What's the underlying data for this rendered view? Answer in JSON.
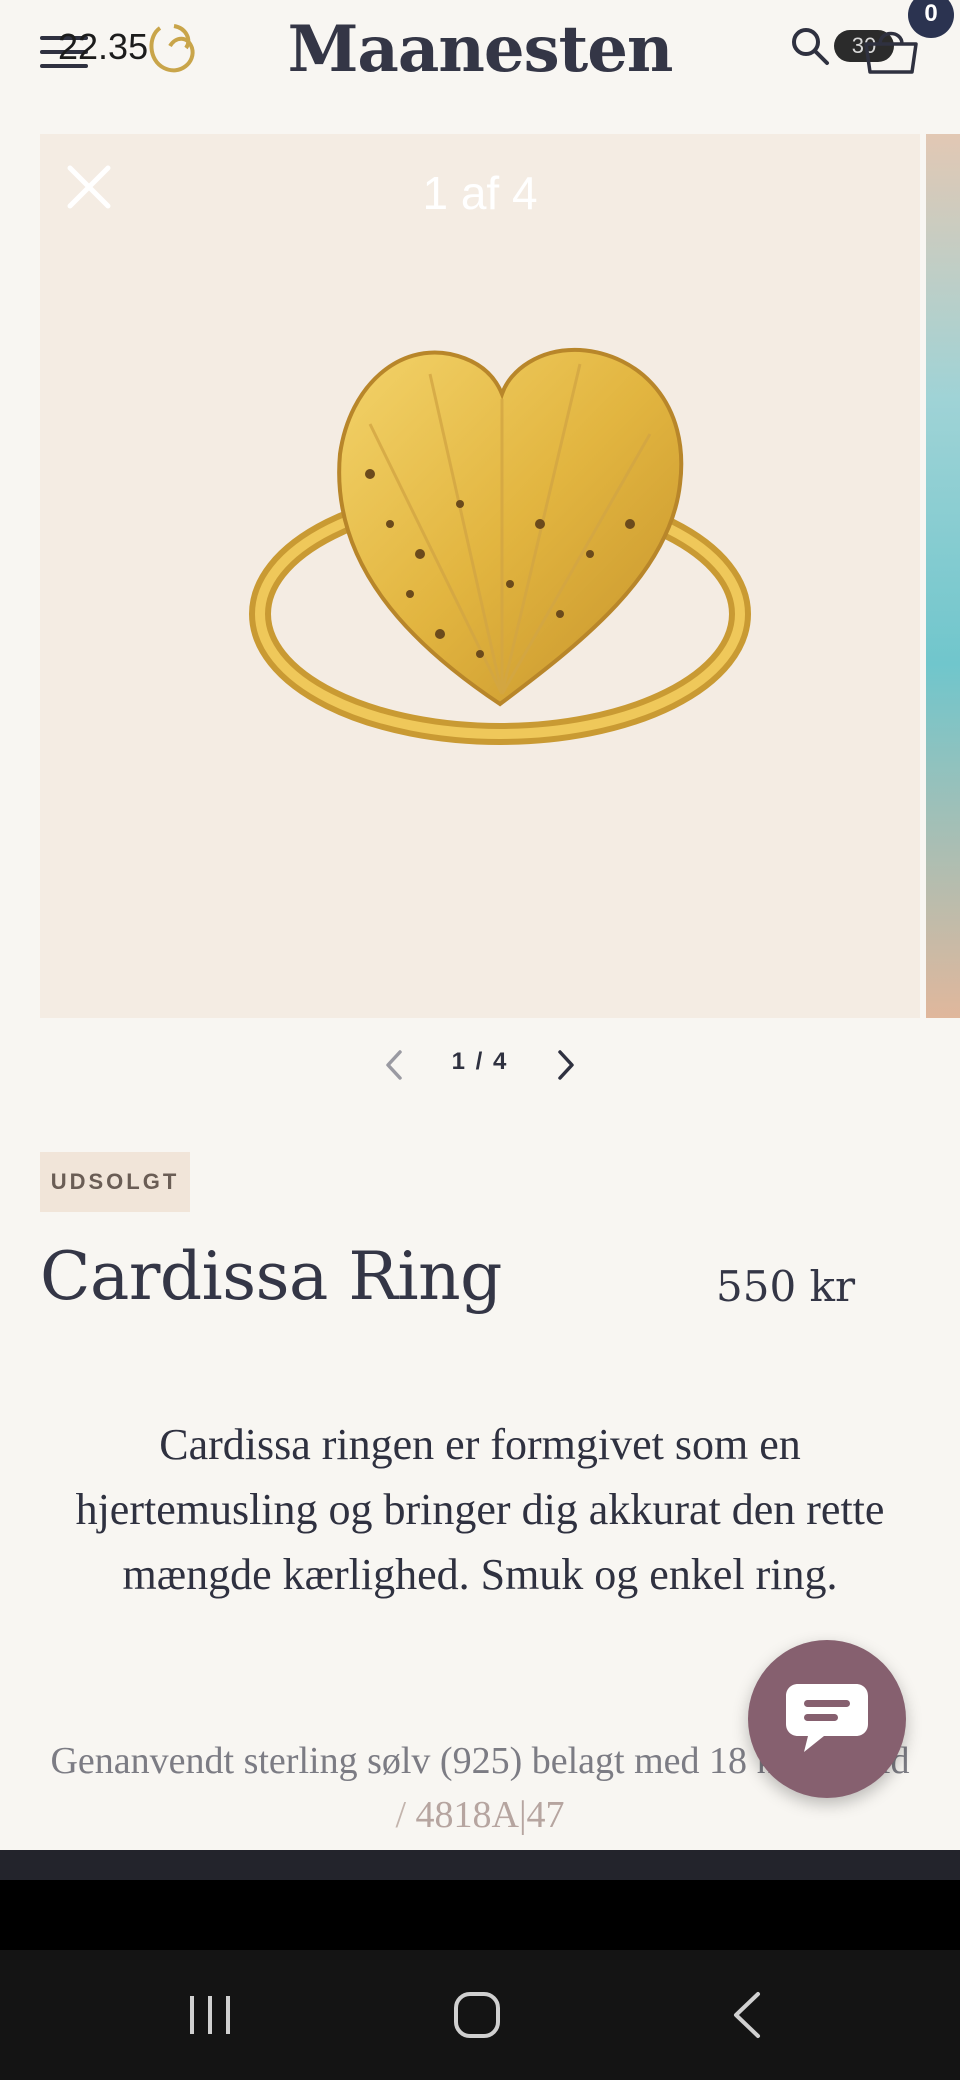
{
  "status_bar": {
    "time": "22.35",
    "right_pill": "30"
  },
  "header": {
    "brand": "Maanesten",
    "cart_count": "0"
  },
  "gallery": {
    "counter": "1 af 4",
    "image_alt": "Gold heart-shaped ring"
  },
  "pagination": {
    "current": "1",
    "separator": "/",
    "total": "4"
  },
  "product": {
    "badge": "UDSOLGT",
    "title": "Cardissa Ring",
    "price": "550 kr",
    "description": "Cardissa ringen er formgivet som en hjertemusling og bringer dig akkurat den rette mængde kærlighed. Smuk og enkel ring.",
    "material": "Genanvendt sterling sølv (925) belagt med 18 karat guld",
    "sku_separator": " / ",
    "sku": "4818A|47"
  },
  "colors": {
    "accent_chat": "#86606f",
    "brand_text": "#343646",
    "gallery_bg": "#f4ece3",
    "badge_bg": "#f1e5d9"
  },
  "icons": {
    "menu": "menu-icon",
    "search": "search-icon",
    "cart": "cart-icon",
    "close": "close-icon",
    "prev": "chevron-left-icon",
    "next": "chevron-right-icon",
    "chat": "chat-icon",
    "nav_recent": "recent-apps-icon",
    "nav_home": "home-icon",
    "nav_back": "back-icon"
  }
}
